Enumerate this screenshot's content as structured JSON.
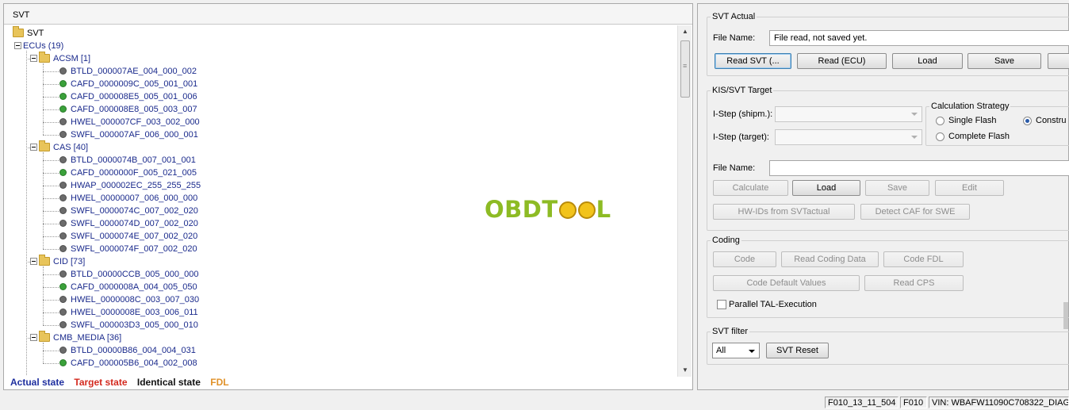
{
  "left_panel": {
    "header": "SVT",
    "root_label": "SVT",
    "ecus_label": "ECUs (19)",
    "groups": [
      {
        "label": "ACSM [1]",
        "items": [
          {
            "label": "BTLD_000007AE_004_000_002",
            "status": "gray"
          },
          {
            "label": "CAFD_0000009C_005_001_001",
            "status": "green"
          },
          {
            "label": "CAFD_000008E5_005_001_006",
            "status": "green"
          },
          {
            "label": "CAFD_000008E8_005_003_007",
            "status": "green"
          },
          {
            "label": "HWEL_000007CF_003_002_000",
            "status": "gray"
          },
          {
            "label": "SWFL_000007AF_006_000_001",
            "status": "gray"
          }
        ]
      },
      {
        "label": "CAS [40]",
        "items": [
          {
            "label": "BTLD_0000074B_007_001_001",
            "status": "gray"
          },
          {
            "label": "CAFD_0000000F_005_021_005",
            "status": "green"
          },
          {
            "label": "HWAP_000002EC_255_255_255",
            "status": "gray"
          },
          {
            "label": "HWEL_00000007_006_000_000",
            "status": "gray"
          },
          {
            "label": "SWFL_0000074C_007_002_020",
            "status": "gray"
          },
          {
            "label": "SWFL_0000074D_007_002_020",
            "status": "gray"
          },
          {
            "label": "SWFL_0000074E_007_002_020",
            "status": "gray"
          },
          {
            "label": "SWFL_0000074F_007_002_020",
            "status": "gray"
          }
        ]
      },
      {
        "label": "CID [73]",
        "items": [
          {
            "label": "BTLD_00000CCB_005_000_000",
            "status": "gray"
          },
          {
            "label": "CAFD_0000008A_004_005_050",
            "status": "green"
          },
          {
            "label": "HWEL_0000008C_003_007_030",
            "status": "gray"
          },
          {
            "label": "HWEL_0000008E_003_006_011",
            "status": "gray"
          },
          {
            "label": "SWFL_000003D3_005_000_010",
            "status": "gray"
          }
        ]
      },
      {
        "label": "CMB_MEDIA [36]",
        "items": [
          {
            "label": "BTLD_00000B86_004_004_031",
            "status": "gray"
          },
          {
            "label": "CAFD_000005B6_004_002_008",
            "status": "green"
          }
        ]
      }
    ],
    "legend": [
      {
        "label": "Actual state",
        "color": "#1f2f9f"
      },
      {
        "label": "Target state",
        "color": "#d42a1f"
      },
      {
        "label": "Identical state",
        "color": "#111111"
      },
      {
        "label": "FDL",
        "color": "#e0922a"
      }
    ],
    "watermark": {
      "prefix": "OBDT",
      "suffix": "L"
    }
  },
  "svt_actual": {
    "title": "SVT Actual",
    "file_name_label": "File Name:",
    "file_name_value": "File read, not saved yet.",
    "buttons": {
      "read_svt": "Read SVT (...",
      "read_ecu": "Read (ECU)",
      "load": "Load",
      "save": "Save"
    }
  },
  "kis_target": {
    "title": "KIS/SVT Target",
    "istep_shipm_label": "I-Step (shipm.):",
    "istep_target_label": "I-Step (target):",
    "calc_strategy": {
      "title": "Calculation Strategy",
      "single_flash": "Single Flash",
      "complete_flash": "Complete Flash",
      "construct": "Constru"
    },
    "file_name_label": "File Name:",
    "buttons": {
      "calculate": "Calculate",
      "load": "Load",
      "save": "Save",
      "edit": "Edit",
      "hwids": "HW-IDs from SVTactual",
      "detect_caf": "Detect CAF for SWE"
    }
  },
  "coding": {
    "title": "Coding",
    "buttons": {
      "code": "Code",
      "read_coding_data": "Read Coding Data",
      "code_fdl": "Code FDL",
      "code_default": "Code Default Values",
      "read_cps": "Read CPS"
    },
    "parallel_tal": "Parallel TAL-Execution"
  },
  "svt_filter": {
    "title": "SVT filter",
    "selected": "All",
    "reset_button": "SVT Reset"
  },
  "statusbar": {
    "istep": "F010_13_11_504",
    "series": "F010",
    "vin": "VIN: WBAFW11090C708322_DIAG"
  }
}
